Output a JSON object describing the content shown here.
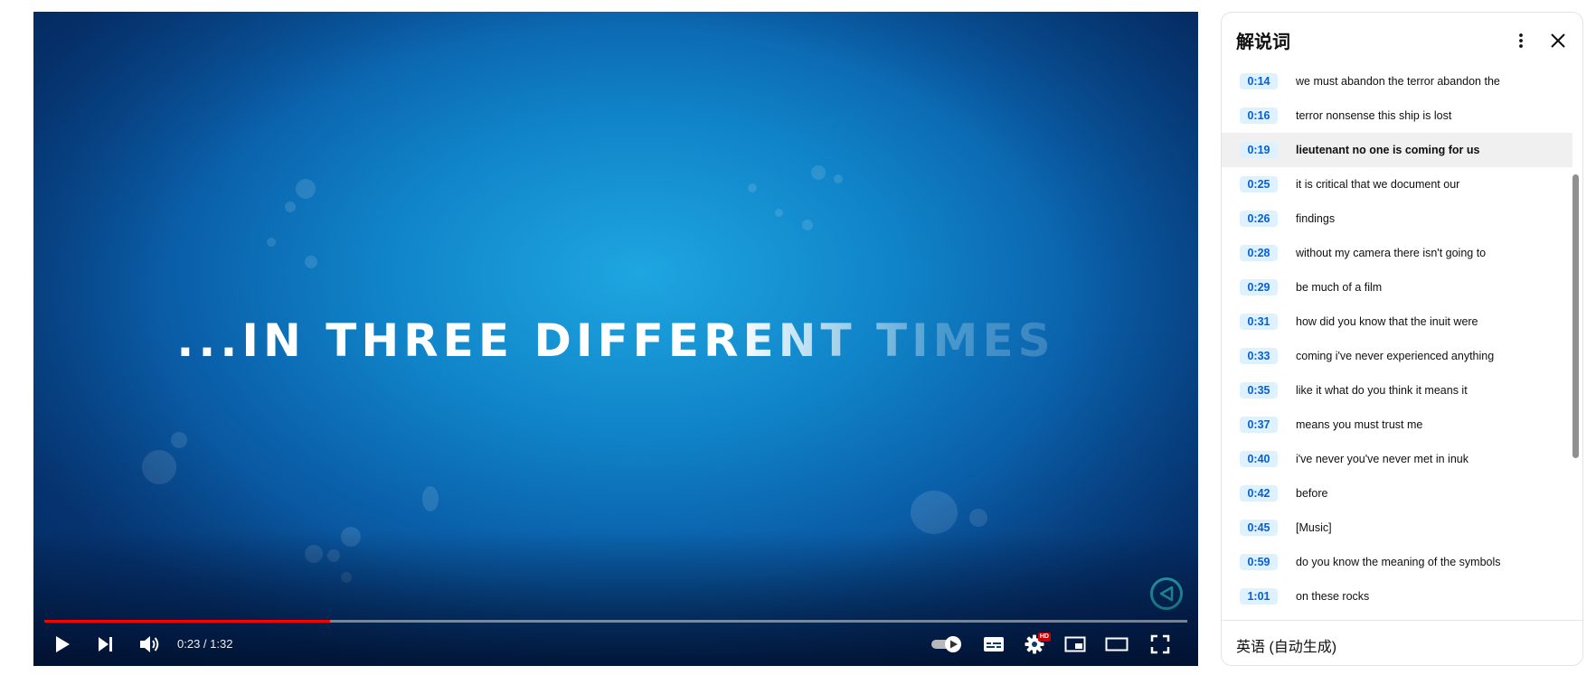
{
  "player": {
    "video_caption": "...IN THREE DIFFERENT TIMES",
    "time_display": "0:23 / 1:32",
    "progress": 0.25,
    "progress_color": "#ff0000",
    "hd_badge": "HD",
    "icons": [
      "play-icon",
      "next-icon",
      "volume-icon",
      "autoplay-toggle-icon",
      "subtitles-icon",
      "settings-icon",
      "miniplayer-icon",
      "theater-mode-icon",
      "fullscreen-icon"
    ]
  },
  "transcript": {
    "title": "解说词",
    "active_index": 2,
    "segments": [
      {
        "time": "0:14",
        "text": "we must abandon the terror abandon the"
      },
      {
        "time": "0:16",
        "text": "terror nonsense this ship is lost"
      },
      {
        "time": "0:19",
        "text": "lieutenant no one is coming for us"
      },
      {
        "time": "0:25",
        "text": "it is critical that we document our"
      },
      {
        "time": "0:26",
        "text": "findings"
      },
      {
        "time": "0:28",
        "text": "without my camera there isn't going to"
      },
      {
        "time": "0:29",
        "text": "be much of a film"
      },
      {
        "time": "0:31",
        "text": "how did you know that the inuit were"
      },
      {
        "time": "0:33",
        "text": "coming i've never experienced anything"
      },
      {
        "time": "0:35",
        "text": "like it what do you think it means it"
      },
      {
        "time": "0:37",
        "text": "means you must trust me"
      },
      {
        "time": "0:40",
        "text": "i've never you've never met in inuk"
      },
      {
        "time": "0:42",
        "text": "before"
      },
      {
        "time": "0:45",
        "text": "[Music]"
      },
      {
        "time": "0:59",
        "text": "do you know the meaning of the symbols"
      },
      {
        "time": "1:01",
        "text": "on these rocks"
      }
    ],
    "language": "英语 (自动生成)"
  },
  "colors": {
    "timestamp_bg": "#def1ff",
    "timestamp_text": "#065fd4",
    "active_row_bg": "#f0f0f0"
  }
}
